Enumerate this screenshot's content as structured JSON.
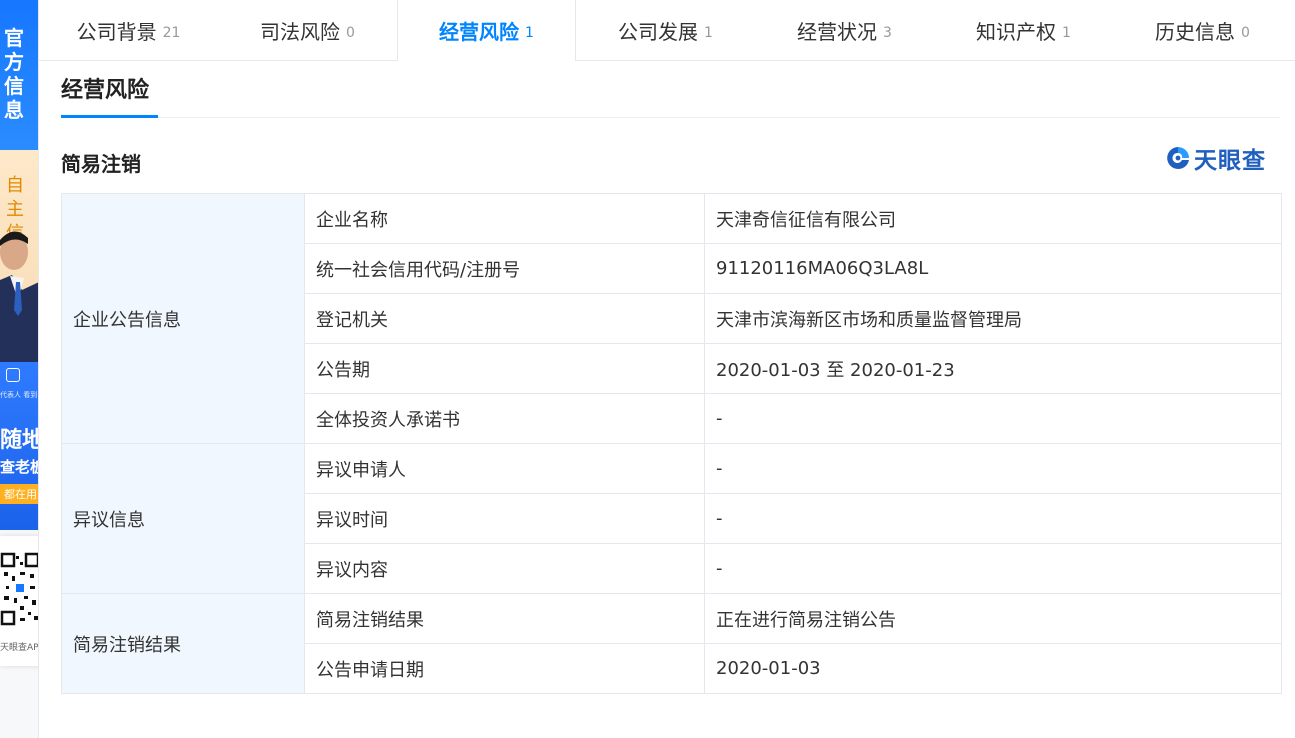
{
  "tabs": [
    {
      "label": "公司背景",
      "count": "21",
      "active": false
    },
    {
      "label": "司法风险",
      "count": "0",
      "active": false
    },
    {
      "label": "经营风险",
      "count": "1",
      "active": true
    },
    {
      "label": "公司发展",
      "count": "1",
      "active": false
    },
    {
      "label": "经营状况",
      "count": "3",
      "active": false
    },
    {
      "label": "知识产权",
      "count": "1",
      "active": false
    },
    {
      "label": "历史信息",
      "count": "0",
      "active": false
    }
  ],
  "promo": {
    "banner_text": "官方信息",
    "banner2_text": "自主信",
    "app_small": "代表人 看到",
    "app_line1": "随地",
    "app_line2": "查老板",
    "app_button": "都在用",
    "qr_label": "天眼查APP"
  },
  "section": {
    "title": "经营风险",
    "subtitle": "简易注销",
    "brand": "天眼查"
  },
  "table": {
    "groups": {
      "notice": "企业公告信息",
      "objection": "异议信息",
      "result": "简易注销结果"
    },
    "rows": {
      "company_name": {
        "label": "企业名称",
        "value": "天津奇信征信有限公司"
      },
      "credit_code": {
        "label": "统一社会信用代码/注册号",
        "value": "91120116MA06Q3LA8L"
      },
      "authority": {
        "label": "登记机关",
        "value": "天津市滨海新区市场和质量监督管理局"
      },
      "notice_period": {
        "label": "公告期",
        "value": "2020-01-03 至 2020-01-23"
      },
      "investor_commitment": {
        "label": "全体投资人承诺书",
        "value": "-"
      },
      "objector": {
        "label": "异议申请人",
        "value": "-"
      },
      "objection_time": {
        "label": "异议时间",
        "value": "-"
      },
      "objection_content": {
        "label": "异议内容",
        "value": "-"
      },
      "cancel_result": {
        "label": "简易注销结果",
        "value": "正在进行简易注销公告"
      },
      "notice_apply_date": {
        "label": "公告申请日期",
        "value": "2020-01-03"
      }
    }
  },
  "colors": {
    "accent": "#0084ff",
    "group_bg": "#f1f7fe",
    "brand": "#1f5fbf"
  }
}
